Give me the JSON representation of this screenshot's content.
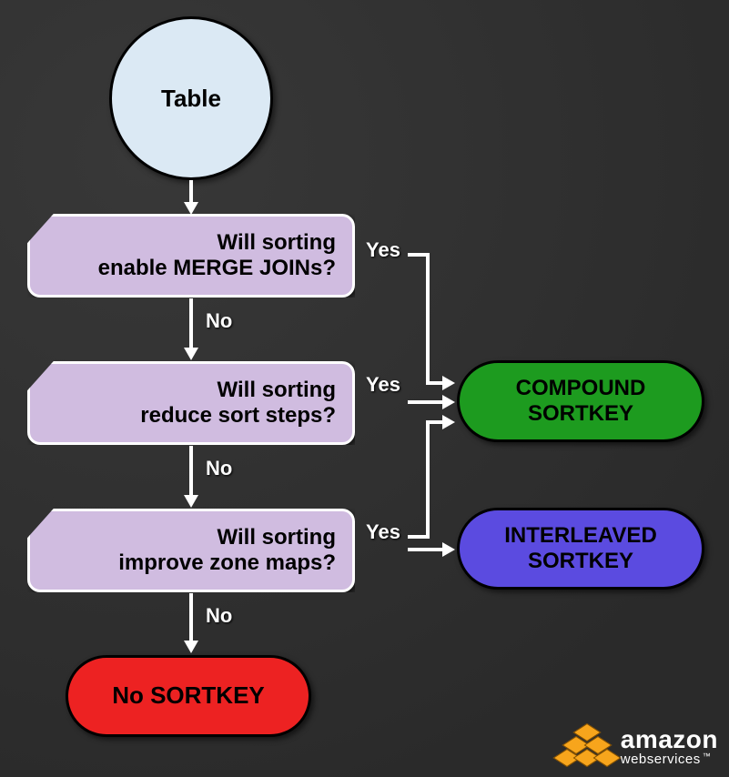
{
  "start": {
    "label": "Table"
  },
  "decisions": {
    "d1": {
      "line1": "Will sorting",
      "line2": "enable MERGE JOINs?"
    },
    "d2": {
      "line1": "Will sorting",
      "line2": "reduce sort steps?"
    },
    "d3": {
      "line1": "Will sorting",
      "line2": "improve zone maps?"
    }
  },
  "edgeLabels": {
    "yes": "Yes",
    "no": "No"
  },
  "outcomes": {
    "compound": {
      "line1": "COMPOUND",
      "line2": "SORTKEY"
    },
    "interleaved": {
      "line1": "INTERLEAVED",
      "line2": "SORTKEY"
    },
    "none": {
      "label": "No SORTKEY"
    }
  },
  "branding": {
    "name": "amazon",
    "sub": "webservices",
    "tm": "™"
  },
  "colors": {
    "bg": "#2e2e2e",
    "start": "#dbe9f4",
    "decision": "#d0bce0",
    "compound": "#1d9b1f",
    "interleaved": "#5b4be0",
    "none": "#ed2222",
    "edge": "#ffffff"
  }
}
